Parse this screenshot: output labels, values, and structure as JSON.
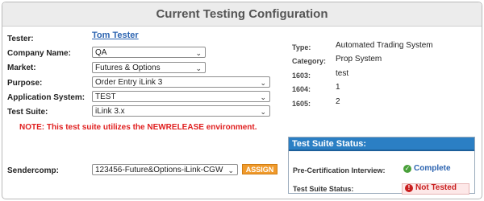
{
  "header": {
    "title": "Current Testing Configuration"
  },
  "form": {
    "tester_label": "Tester:",
    "tester_name": "Tom Tester",
    "company_label": "Company Name:",
    "company_value": "QA",
    "market_label": "Market:",
    "market_value": "Futures & Options",
    "purpose_label": "Purpose:",
    "purpose_value": "Order Entry iLink 3",
    "appsys_label": "Application System:",
    "appsys_value": "TEST",
    "suite_label": "Test Suite:",
    "suite_value": "iLink 3.x",
    "note": "NOTE: This test suite utilizes the NEWRELEASE environment.",
    "sendercomp_label": "Sendercomp:",
    "sendercomp_value": "123456-Future&Options-iLink-CGW",
    "assign_label": "ASSIGN"
  },
  "details": {
    "type_label": "Type:",
    "type_value": "Automated Trading System",
    "category_label": "Category:",
    "category_value": "Prop System",
    "f1603_label": "1603:",
    "f1603_value": "test",
    "f1604_label": "1604:",
    "f1604_value": "1",
    "f1605_label": "1605:",
    "f1605_value": "2"
  },
  "status": {
    "header": "Test Suite Status:",
    "precert_label": "Pre-Certification Interview:",
    "precert_value": "Complete",
    "suite_status_label": "Test Suite Status:",
    "suite_status_value": "Not Tested",
    "colors": {
      "complete": "#2b63b0",
      "not_tested": "#c91e1e",
      "header_bg": "#2b7fc4"
    },
    "icons": {
      "complete": "check-circle-icon",
      "not_tested": "error-circle-icon"
    }
  }
}
